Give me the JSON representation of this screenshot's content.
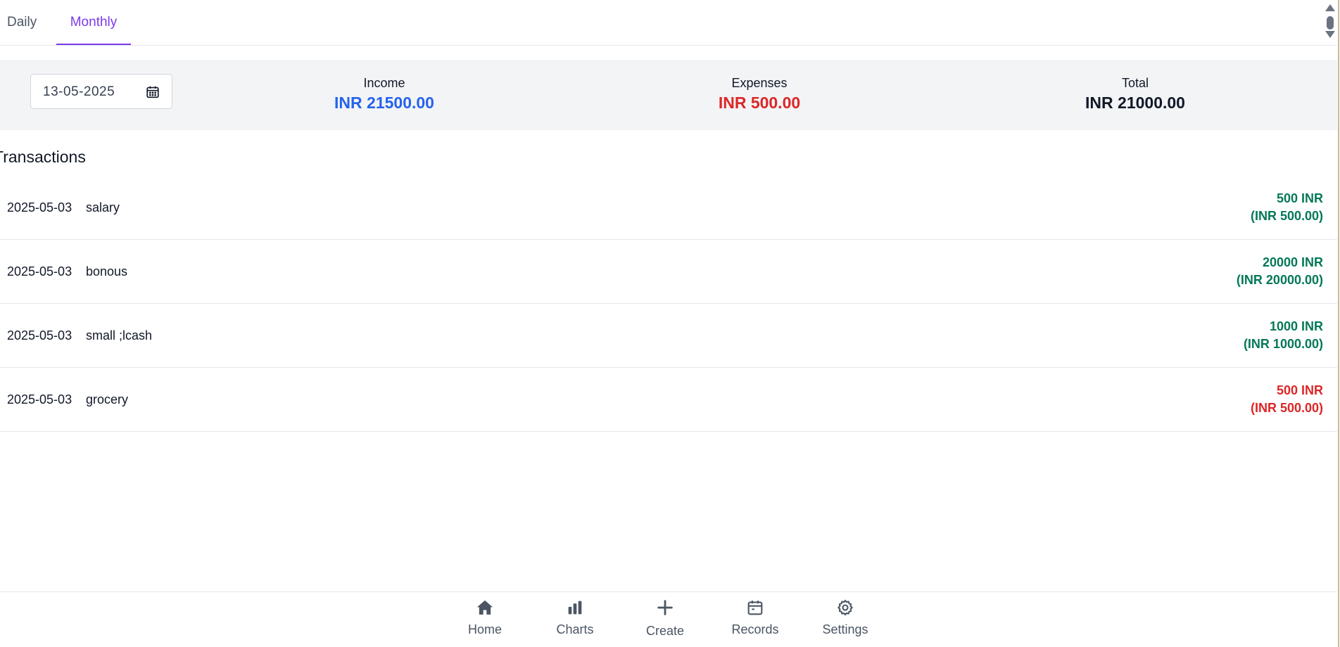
{
  "tabs": [
    {
      "label": "Daily",
      "active": false
    },
    {
      "label": "Monthly",
      "active": true
    }
  ],
  "summary": {
    "date_value": "13-05-2025",
    "income": {
      "label": "Income",
      "value": "INR 21500.00",
      "color": "#2563eb"
    },
    "expenses": {
      "label": "Expenses",
      "value": "INR 500.00",
      "color": "#dc2626"
    },
    "total": {
      "label": "Total",
      "value": "INR 21000.00",
      "color": "#111827"
    }
  },
  "transactions": {
    "title": "Transactions",
    "rows": [
      {
        "date": "2025-05-03",
        "note": "salary",
        "amount": "500 INR",
        "converted": "(INR 500.00)",
        "type": "income"
      },
      {
        "date": "2025-05-03",
        "note": "bonous",
        "amount": "20000 INR",
        "converted": "(INR 20000.00)",
        "type": "income"
      },
      {
        "date": "2025-05-03",
        "note": "small ;lcash",
        "amount": "1000 INR",
        "converted": "(INR 1000.00)",
        "type": "income"
      },
      {
        "date": "2025-05-03",
        "note": "grocery",
        "amount": "500 INR",
        "converted": "(INR 500.00)",
        "type": "expense"
      }
    ]
  },
  "nav": {
    "items": [
      {
        "label": "Home",
        "icon": "home-icon"
      },
      {
        "label": "Charts",
        "icon": "bar-chart-icon"
      },
      {
        "label": "Create",
        "icon": "plus-icon"
      },
      {
        "label": "Records",
        "icon": "calendar-icon"
      },
      {
        "label": "Settings",
        "icon": "gear-icon"
      }
    ]
  },
  "colors": {
    "accent": "#7c3aed",
    "income_green": "#047857",
    "expense_red": "#dc2626",
    "income_blue": "#2563eb"
  }
}
